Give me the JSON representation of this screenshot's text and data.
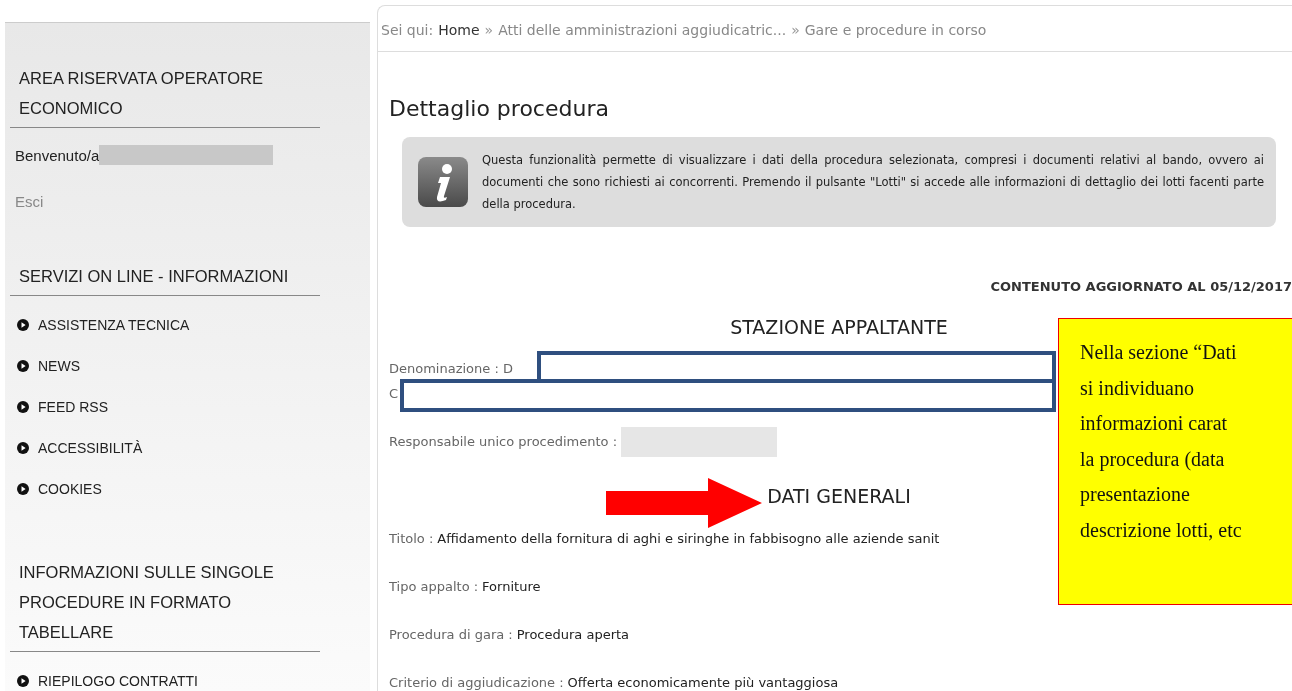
{
  "sidebar": {
    "sections": [
      {
        "kind": "login",
        "title": "AREA RISERVATA OPERATORE ECONOMICO",
        "welcome": "Benvenuto/a",
        "logout": "Esci"
      },
      {
        "kind": "menu",
        "title": "SERVIZI ON LINE - INFORMAZIONI",
        "items": [
          "ASSISTENZA TECNICA",
          "NEWS",
          "FEED RSS",
          "ACCESSIBILITÀ",
          "COOKIES"
        ]
      },
      {
        "kind": "menu",
        "title": "INFORMAZIONI SULLE SINGOLE PROCEDURE IN FORMATO TABELLARE",
        "items": [
          "RIEPILOGO CONTRATTI"
        ]
      }
    ]
  },
  "breadcrumb": {
    "label": "Sei qui:",
    "items": [
      {
        "text": "Home",
        "kind": "home"
      },
      {
        "text": "»",
        "kind": "separator"
      },
      {
        "text": "Atti delle amministrazioni aggiudicatric...",
        "kind": "link"
      },
      {
        "text": "»",
        "kind": "separator"
      },
      {
        "text": "Gare e procedure in corso",
        "kind": "link"
      }
    ]
  },
  "page_title": "Dettaglio procedura",
  "info_box": "Questa funzionalità permette di visualizzare i dati della procedura selezionata, compresi i documenti relativi al bando, ovvero ai documenti che sono richiesti ai concorrenti. Premendo il pulsante \"Lotti\" si accede alle informazioni di dettaglio dei lotti facenti parte della procedura.",
  "updated": "CONTENUTO AGGIORNATO AL 05/12/2017",
  "sections": [
    {
      "title": "STAZIONE APPALTANTE",
      "fields": [
        {
          "label": "Denominazione : D",
          "kind": "covered"
        },
        {
          "label": "C",
          "kind": "covered-line"
        },
        {
          "label": "Responsabile unico procedimento :",
          "kind": "redacted"
        }
      ]
    },
    {
      "title": "DATI GENERALI",
      "fields": [
        {
          "label": "Titolo :",
          "value": "Affidamento della fornitura di aghi e siringhe in fabbisogno alle aziende sanit",
          "kind": "text"
        },
        {
          "label": "Tipo appalto :",
          "value": "Forniture",
          "kind": "text"
        },
        {
          "label": "Procedura di gara :",
          "value": "Procedura aperta",
          "kind": "text"
        },
        {
          "label": "Criterio di aggiudicazione :",
          "value": "Offerta economicamente più vantaggiosa",
          "kind": "text"
        }
      ]
    }
  ],
  "callout": {
    "lines": [
      "Nella sezione “Dati",
      "si individuano",
      "informazioni carat",
      "la procedura (data",
      "presentazione",
      "descrizione lotti, etc"
    ]
  }
}
